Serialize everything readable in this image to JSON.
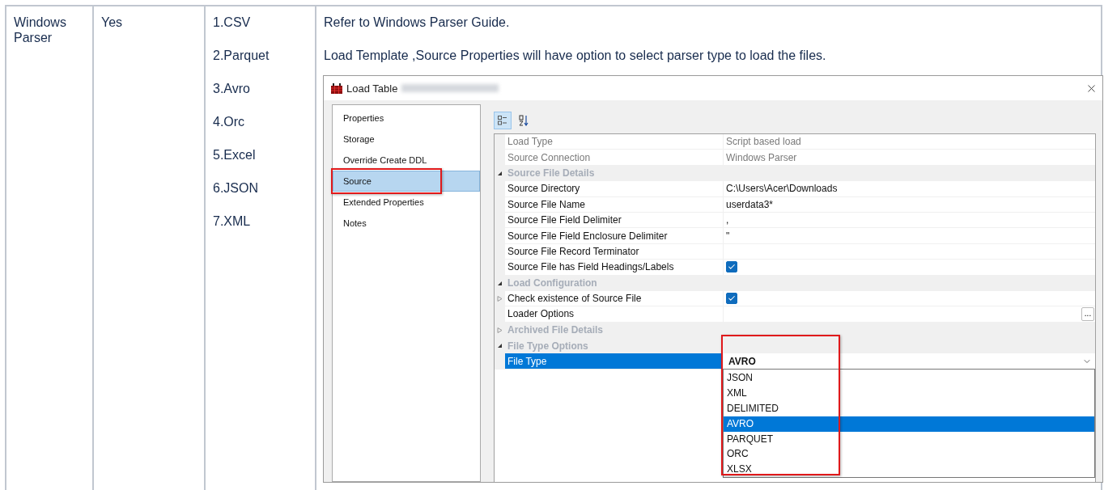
{
  "table": {
    "name": "Windows Parser",
    "supported": "Yes",
    "formats": [
      "1.CSV",
      "2.Parquet",
      "3.Avro",
      "4.Orc",
      "5.Excel",
      "6.JSON",
      "7.XML"
    ],
    "notes": [
      "Refer to Windows Parser Guide.",
      "Load Template ,Source Properties will have option to select parser type to load the files."
    ],
    "dialog": {
      "title": "Load Table",
      "nav": [
        {
          "label": "Properties",
          "selected": false,
          "annotated": false
        },
        {
          "label": "Storage",
          "selected": false,
          "annotated": false
        },
        {
          "label": "Override Create DDL",
          "selected": false,
          "annotated": false
        },
        {
          "label": "Source",
          "selected": true,
          "annotated": true
        },
        {
          "label": "Extended Properties",
          "selected": false,
          "annotated": false
        },
        {
          "label": "Notes",
          "selected": false,
          "annotated": false
        }
      ],
      "toolbar": [
        {
          "kind": "categorized",
          "selected": true
        },
        {
          "kind": "alphabetical",
          "selected": false
        }
      ],
      "rows": [
        {
          "kind": "property",
          "name": "Load Type",
          "value": "Script based load",
          "disabled": true
        },
        {
          "kind": "property",
          "name": "Source Connection",
          "value": "Windows Parser",
          "disabled": true
        },
        {
          "kind": "category",
          "label": "Source File Details",
          "expanded": true
        },
        {
          "kind": "property",
          "name": "Source Directory",
          "value": "C:\\Users\\Acer\\Downloads",
          "disabled": false
        },
        {
          "kind": "property",
          "name": "Source File Name",
          "value": "userdata3*",
          "disabled": false
        },
        {
          "kind": "property",
          "name": "Source File Field Delimiter",
          "value": ",",
          "disabled": false
        },
        {
          "kind": "property",
          "name": "Source File Field Enclosure Delimiter",
          "value": "\"",
          "disabled": false
        },
        {
          "kind": "property",
          "name": "Source File Record Terminator",
          "disabled": false
        },
        {
          "kind": "checkbox",
          "name": "Source File has Field Headings/Labels",
          "checked": true
        },
        {
          "kind": "category",
          "label": "Load Configuration",
          "expanded": true
        },
        {
          "kind": "checkbox",
          "name": "Check existence of Source File",
          "checked": true,
          "expanded": false
        },
        {
          "kind": "button",
          "name": "Loader Options",
          "button": "..."
        },
        {
          "kind": "category",
          "label": "Archived File Details",
          "expanded": false
        },
        {
          "kind": "category",
          "label": "File Type Options",
          "expanded": true
        },
        {
          "kind": "dropdown",
          "name": "File Type",
          "value": "AVRO",
          "selected": true,
          "annotated": true,
          "options": [
            {
              "label": "JSON",
              "selected": false
            },
            {
              "label": "XML",
              "selected": false
            },
            {
              "label": "DELIMITED",
              "selected": false
            },
            {
              "label": "AVRO",
              "selected": true
            },
            {
              "label": "PARQUET",
              "selected": false
            },
            {
              "label": "ORC",
              "selected": false
            },
            {
              "label": "XLSX",
              "selected": false
            }
          ]
        }
      ]
    }
  }
}
